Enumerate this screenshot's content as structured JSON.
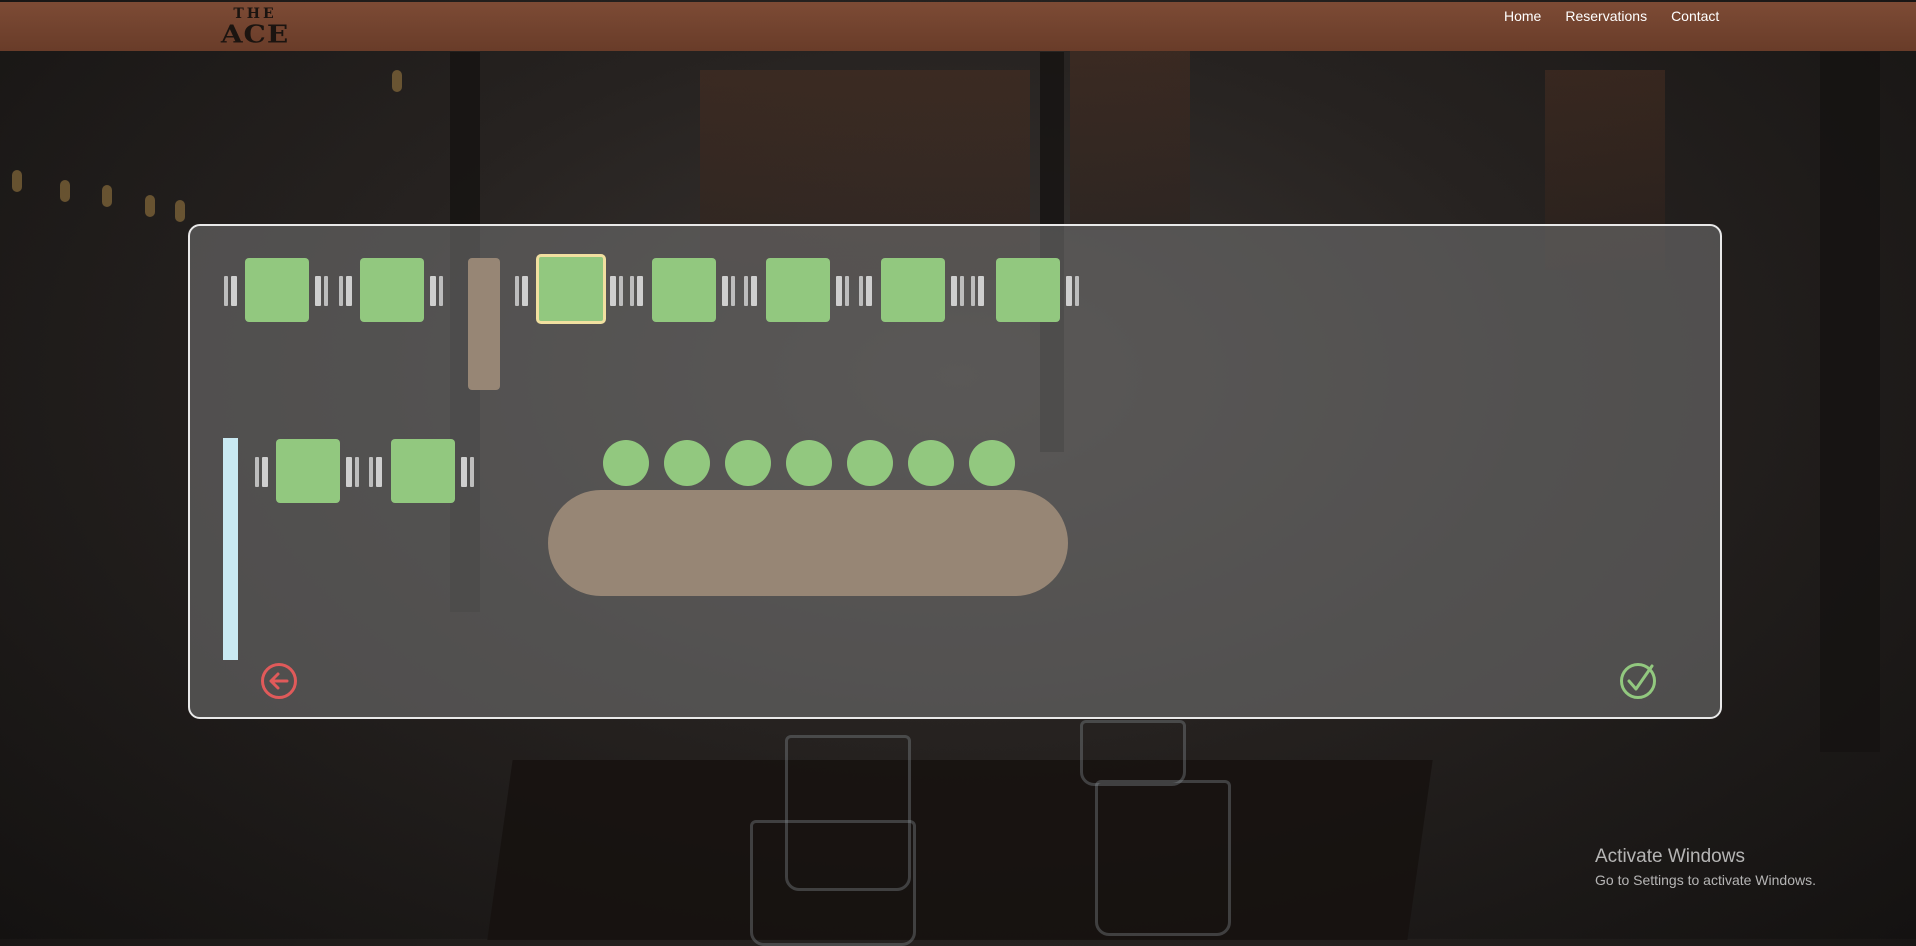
{
  "brand": {
    "logo_top": "THE",
    "logo_main": "ACE"
  },
  "nav": {
    "items": [
      "Home",
      "Reservations",
      "Contact"
    ]
  },
  "floor_plan": {
    "colors": {
      "available": "#92c87f",
      "selected_border": "#f1e0a0",
      "fixture": "#978675",
      "door": "#c9e9f2"
    },
    "tables_row1_count": 7,
    "tables_row2_count": 2,
    "bar_stools_count": 7,
    "selected_table_index": 2
  },
  "actions": {
    "back_icon": "arrow-left-circle-icon",
    "confirm_icon": "check-circle-icon",
    "back_color": "#e05a5a",
    "confirm_color": "#92c87f"
  },
  "watermark": {
    "title": "Activate Windows",
    "subtitle": "Go to Settings to activate Windows."
  }
}
